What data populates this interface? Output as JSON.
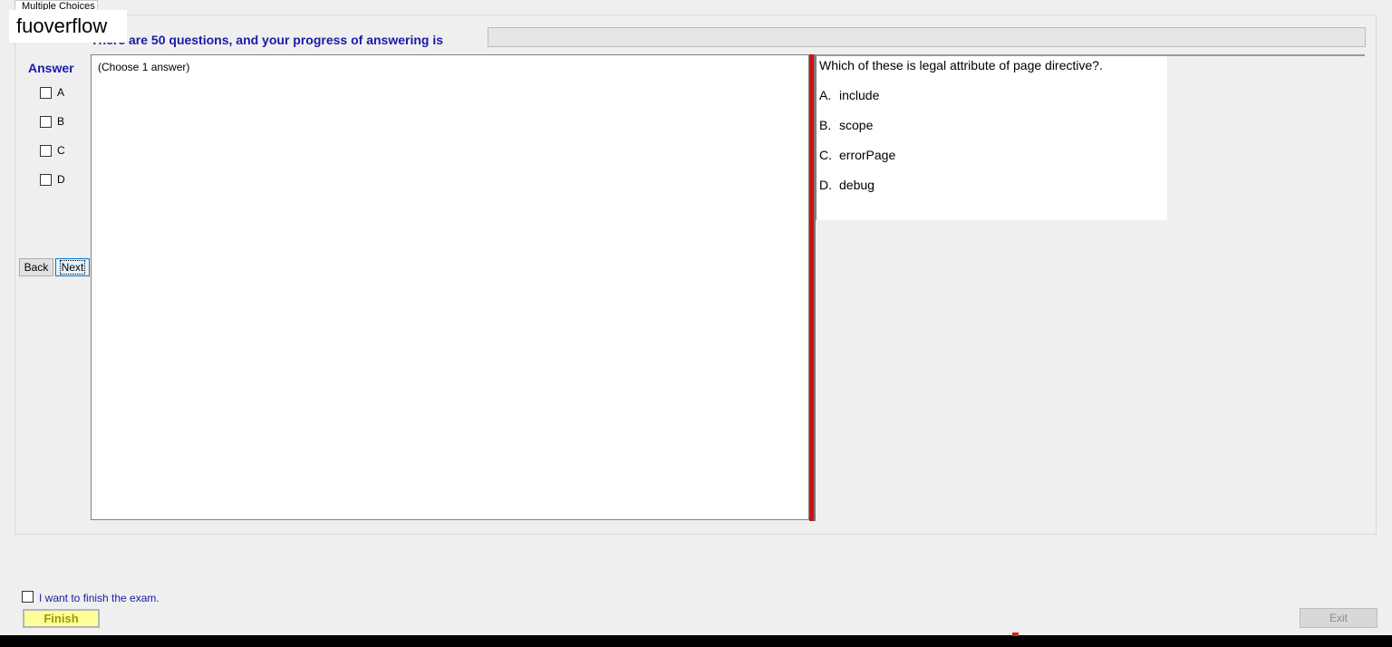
{
  "tab": {
    "label": "Multiple Choices"
  },
  "watermark": "fuoverflow",
  "progress": {
    "label": "There are 50 questions, and your progress of answering is",
    "value": 0
  },
  "answer": {
    "label": "Answer",
    "options": [
      "A",
      "B",
      "C",
      "D"
    ],
    "area_text": "(Choose 1 answer)"
  },
  "nav": {
    "back_label": "Back",
    "next_label": "Next"
  },
  "question": {
    "text": "Which of these is legal attribute of page directive?.",
    "options": [
      {
        "letter": "A.",
        "text": "include"
      },
      {
        "letter": "B.",
        "text": "scope"
      },
      {
        "letter": "C.",
        "text": "errorPage"
      },
      {
        "letter": "D.",
        "text": "debug"
      }
    ]
  },
  "footer": {
    "finish_checkbox_label": "I want to finish the exam.",
    "finish_label": "Finish",
    "exit_label": "Exit"
  },
  "colors": {
    "accent_text": "#1a1aa8",
    "splitter": "#d11111",
    "finish_bg": "#ffff99"
  }
}
